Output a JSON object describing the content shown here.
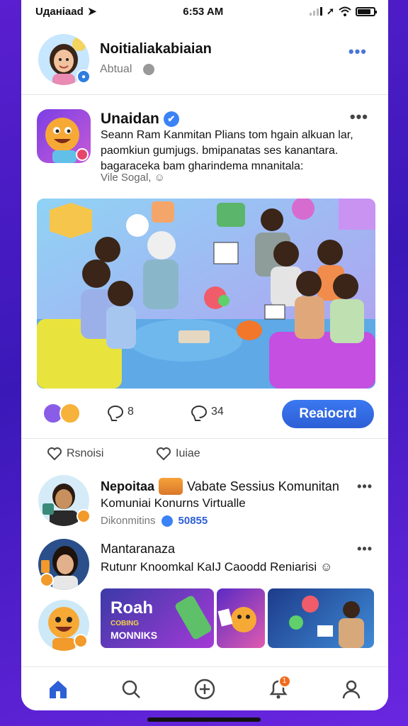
{
  "status_bar": {
    "carrier": "Uданiaad",
    "time": "6:53 AM"
  },
  "header": {
    "name": "Noitialiakabiaian",
    "subtitle": "Abtual"
  },
  "post": {
    "name": "Unaidan",
    "text": "Seann Ram Kanmitan Plians tom hgain alkuan lar, paomkiun gumjugs. bmipanatas ses kanantara. bagaraceka bam gharindema mnanitala:",
    "meta": "Vile Sogal,"
  },
  "actions": {
    "comments": "8",
    "shares": "34",
    "primary_button": "Reaiocrd"
  },
  "likes_row": {
    "like_label": "Rsnoisi",
    "save_label": "Iuiae"
  },
  "feed": [
    {
      "name": "Nepoitaa",
      "title_rest": "Vabate Sessius Komunitan",
      "line": "Komuniai Konurns Virtualle",
      "meta_text": "Dikonmitins",
      "meta_count": "50855"
    },
    {
      "name": "Mantaranaza",
      "line": "Rutunr Knoomkal KaIJ Caoodd Reniarisi"
    }
  ],
  "thumbnail": {
    "title": "Roah",
    "subtitle": "COBING",
    "caption": "MONNIKS"
  },
  "tabbar": {
    "notification_count": "1"
  },
  "colors": {
    "accent": "#2d5fd6",
    "background": "#4a1ec4",
    "notification": "#f26b1d"
  },
  "icons": [
    "home-icon",
    "search-icon",
    "add-icon",
    "notifications-icon",
    "profile-icon"
  ]
}
